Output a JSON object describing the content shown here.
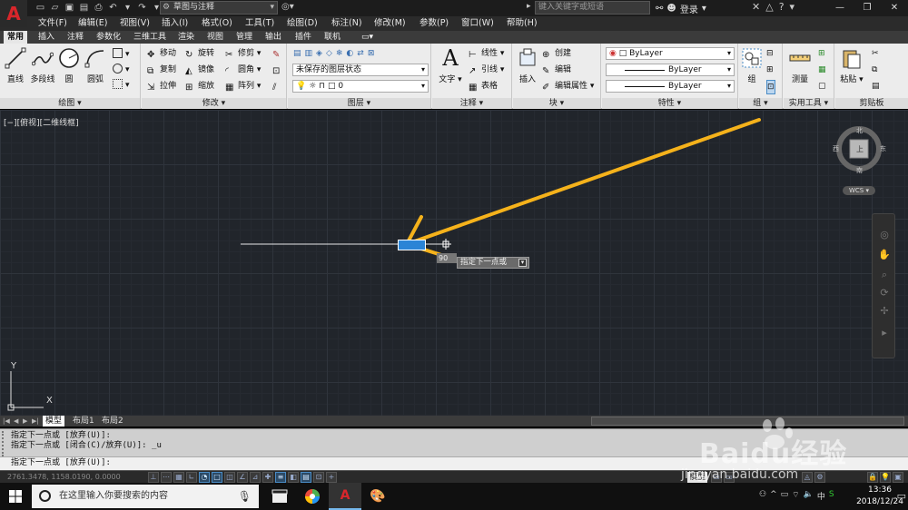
{
  "app": {
    "logo_letter": "A",
    "workspace": "草图与注释",
    "search_placeholder": "键入关键字或短语",
    "login": "登录",
    "brand_color": "#d9262b"
  },
  "menu": [
    "文件(F)",
    "编辑(E)",
    "视图(V)",
    "插入(I)",
    "格式(O)",
    "工具(T)",
    "绘图(D)",
    "标注(N)",
    "修改(M)",
    "参数(P)",
    "窗口(W)",
    "帮助(H)"
  ],
  "ribbon_tabs": [
    "常用",
    "插入",
    "注释",
    "参数化",
    "三维工具",
    "渲染",
    "视图",
    "管理",
    "输出",
    "插件",
    "联机"
  ],
  "ribbon": {
    "draw": {
      "title": "绘图",
      "line": "直线",
      "polyline": "多段线",
      "circle": "圆",
      "arc": "圆弧"
    },
    "modify": {
      "title": "修改",
      "move": "移动",
      "rotate": "旋转",
      "trim": "修剪",
      "copy": "复制",
      "mirror": "镜像",
      "fillet": "圆角",
      "stretch": "拉伸",
      "scale": "缩放",
      "array": "阵列"
    },
    "layers": {
      "title": "图层",
      "state": "未保存的图层状态",
      "current_layer": "0"
    },
    "annotation": {
      "title": "注释",
      "text": "文字",
      "linear": "线性",
      "leader": "引线",
      "table": "表格"
    },
    "block": {
      "title": "块",
      "insert": "插入",
      "create": "创建",
      "edit": "编辑",
      "edit_attributes": "编辑属性"
    },
    "properties": {
      "title": "特性",
      "color": "ByLayer",
      "linetype": "ByLayer",
      "lineweight": "ByLayer"
    },
    "groups": {
      "title": "组",
      "group": "组"
    },
    "utilities": {
      "title": "实用工具",
      "measure": "测量"
    },
    "clipboard": {
      "title": "剪贴板",
      "paste": "粘贴"
    }
  },
  "viewport": {
    "label": "[−][俯视][二维线框]",
    "viewcube": {
      "north": "北",
      "south": "南",
      "east": "东",
      "west": "西",
      "top": "上"
    },
    "wcs": "WCS",
    "ucs_x": "X",
    "ucs_y": "Y",
    "dynamic_angle": "90",
    "dynamic_prompt": "指定下一点或"
  },
  "layout_tabs": [
    "模型",
    "布局1",
    "布局2"
  ],
  "command": {
    "history": [
      "指定下一点或 [放弃(U)]:",
      "指定下一点或 [闭合(C)/放弃(U)]: _u"
    ],
    "current": "指定下一点或 [放弃(U)]:"
  },
  "status": {
    "coords": "2761.3478, 1158.0190, 0.0000",
    "model": "模型"
  },
  "taskbar": {
    "search_placeholder": "在这里输入你要搜索的内容",
    "time": "13:36",
    "date": "2018/12/24"
  },
  "watermark": {
    "brand": "Baidu经验",
    "url": "jingyan.baidu.com"
  },
  "annotation_color": "#f5b21b"
}
